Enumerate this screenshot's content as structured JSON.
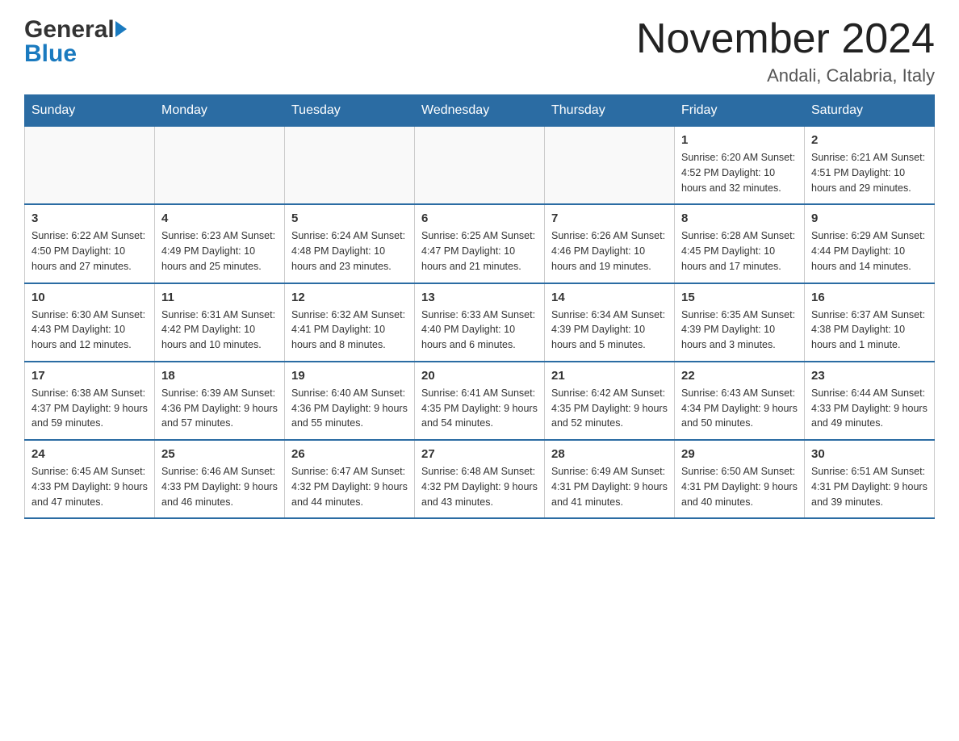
{
  "header": {
    "logo_general": "General",
    "logo_blue": "Blue",
    "month_title": "November 2024",
    "location": "Andali, Calabria, Italy"
  },
  "days_of_week": [
    "Sunday",
    "Monday",
    "Tuesday",
    "Wednesday",
    "Thursday",
    "Friday",
    "Saturday"
  ],
  "weeks": [
    {
      "days": [
        {
          "number": "",
          "info": ""
        },
        {
          "number": "",
          "info": ""
        },
        {
          "number": "",
          "info": ""
        },
        {
          "number": "",
          "info": ""
        },
        {
          "number": "",
          "info": ""
        },
        {
          "number": "1",
          "info": "Sunrise: 6:20 AM\nSunset: 4:52 PM\nDaylight: 10 hours\nand 32 minutes."
        },
        {
          "number": "2",
          "info": "Sunrise: 6:21 AM\nSunset: 4:51 PM\nDaylight: 10 hours\nand 29 minutes."
        }
      ]
    },
    {
      "days": [
        {
          "number": "3",
          "info": "Sunrise: 6:22 AM\nSunset: 4:50 PM\nDaylight: 10 hours\nand 27 minutes."
        },
        {
          "number": "4",
          "info": "Sunrise: 6:23 AM\nSunset: 4:49 PM\nDaylight: 10 hours\nand 25 minutes."
        },
        {
          "number": "5",
          "info": "Sunrise: 6:24 AM\nSunset: 4:48 PM\nDaylight: 10 hours\nand 23 minutes."
        },
        {
          "number": "6",
          "info": "Sunrise: 6:25 AM\nSunset: 4:47 PM\nDaylight: 10 hours\nand 21 minutes."
        },
        {
          "number": "7",
          "info": "Sunrise: 6:26 AM\nSunset: 4:46 PM\nDaylight: 10 hours\nand 19 minutes."
        },
        {
          "number": "8",
          "info": "Sunrise: 6:28 AM\nSunset: 4:45 PM\nDaylight: 10 hours\nand 17 minutes."
        },
        {
          "number": "9",
          "info": "Sunrise: 6:29 AM\nSunset: 4:44 PM\nDaylight: 10 hours\nand 14 minutes."
        }
      ]
    },
    {
      "days": [
        {
          "number": "10",
          "info": "Sunrise: 6:30 AM\nSunset: 4:43 PM\nDaylight: 10 hours\nand 12 minutes."
        },
        {
          "number": "11",
          "info": "Sunrise: 6:31 AM\nSunset: 4:42 PM\nDaylight: 10 hours\nand 10 minutes."
        },
        {
          "number": "12",
          "info": "Sunrise: 6:32 AM\nSunset: 4:41 PM\nDaylight: 10 hours\nand 8 minutes."
        },
        {
          "number": "13",
          "info": "Sunrise: 6:33 AM\nSunset: 4:40 PM\nDaylight: 10 hours\nand 6 minutes."
        },
        {
          "number": "14",
          "info": "Sunrise: 6:34 AM\nSunset: 4:39 PM\nDaylight: 10 hours\nand 5 minutes."
        },
        {
          "number": "15",
          "info": "Sunrise: 6:35 AM\nSunset: 4:39 PM\nDaylight: 10 hours\nand 3 minutes."
        },
        {
          "number": "16",
          "info": "Sunrise: 6:37 AM\nSunset: 4:38 PM\nDaylight: 10 hours\nand 1 minute."
        }
      ]
    },
    {
      "days": [
        {
          "number": "17",
          "info": "Sunrise: 6:38 AM\nSunset: 4:37 PM\nDaylight: 9 hours\nand 59 minutes."
        },
        {
          "number": "18",
          "info": "Sunrise: 6:39 AM\nSunset: 4:36 PM\nDaylight: 9 hours\nand 57 minutes."
        },
        {
          "number": "19",
          "info": "Sunrise: 6:40 AM\nSunset: 4:36 PM\nDaylight: 9 hours\nand 55 minutes."
        },
        {
          "number": "20",
          "info": "Sunrise: 6:41 AM\nSunset: 4:35 PM\nDaylight: 9 hours\nand 54 minutes."
        },
        {
          "number": "21",
          "info": "Sunrise: 6:42 AM\nSunset: 4:35 PM\nDaylight: 9 hours\nand 52 minutes."
        },
        {
          "number": "22",
          "info": "Sunrise: 6:43 AM\nSunset: 4:34 PM\nDaylight: 9 hours\nand 50 minutes."
        },
        {
          "number": "23",
          "info": "Sunrise: 6:44 AM\nSunset: 4:33 PM\nDaylight: 9 hours\nand 49 minutes."
        }
      ]
    },
    {
      "days": [
        {
          "number": "24",
          "info": "Sunrise: 6:45 AM\nSunset: 4:33 PM\nDaylight: 9 hours\nand 47 minutes."
        },
        {
          "number": "25",
          "info": "Sunrise: 6:46 AM\nSunset: 4:33 PM\nDaylight: 9 hours\nand 46 minutes."
        },
        {
          "number": "26",
          "info": "Sunrise: 6:47 AM\nSunset: 4:32 PM\nDaylight: 9 hours\nand 44 minutes."
        },
        {
          "number": "27",
          "info": "Sunrise: 6:48 AM\nSunset: 4:32 PM\nDaylight: 9 hours\nand 43 minutes."
        },
        {
          "number": "28",
          "info": "Sunrise: 6:49 AM\nSunset: 4:31 PM\nDaylight: 9 hours\nand 41 minutes."
        },
        {
          "number": "29",
          "info": "Sunrise: 6:50 AM\nSunset: 4:31 PM\nDaylight: 9 hours\nand 40 minutes."
        },
        {
          "number": "30",
          "info": "Sunrise: 6:51 AM\nSunset: 4:31 PM\nDaylight: 9 hours\nand 39 minutes."
        }
      ]
    }
  ]
}
